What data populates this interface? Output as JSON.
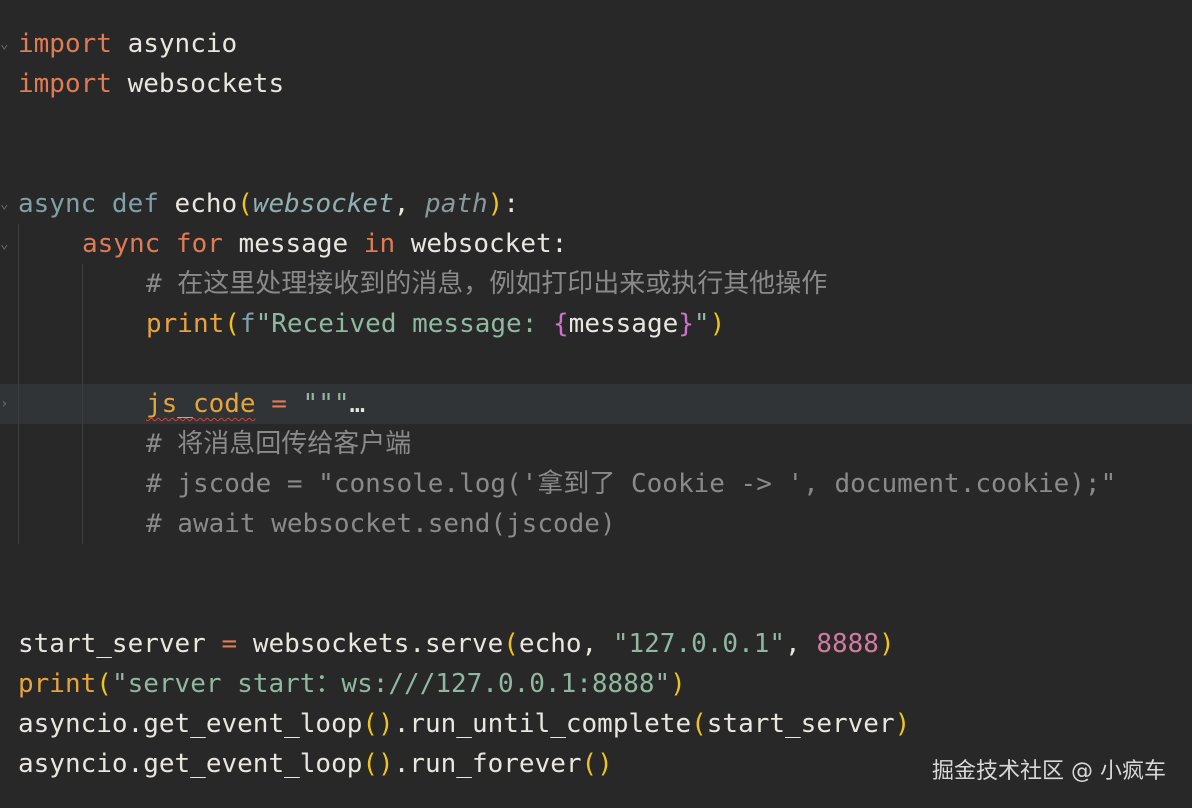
{
  "lines": {
    "l1_kw": "import",
    "l1_mod": " asyncio",
    "l2_kw": "import",
    "l2_mod": " websockets",
    "l5_async": "async",
    "l5_def": " def",
    "l5_name": " echo",
    "l5_p1": "websocket",
    "l5_comma": ", ",
    "l5_p2": "path",
    "l5_colon": ":",
    "l6_async": "async",
    "l6_for": " for",
    "l6_var": " message",
    "l6_in": " in",
    "l6_iter": " websocket:",
    "l7_comment": "# 在这里处理接收到的消息，例如打印出来或执行其他操作",
    "l8_print": "print",
    "l8_f": "f",
    "l8_str1": "\"Received message: ",
    "l8_var": "message",
    "l8_str2": "\"",
    "l10_var": "js_code",
    "l10_eq": " = ",
    "l10_str": "\"\"\"",
    "l10_ellipsis": "…",
    "l11_comment": "# 将消息回传给客户端",
    "l12_comment": "# jscode = \"console.log('拿到了 Cookie -> ', document.cookie);\"",
    "l13_comment": "# await websocket.send(jscode)",
    "l16_var": "start_server",
    "l16_eq": " = ",
    "l16_call": "websockets.serve",
    "l16_arg1": "echo, ",
    "l16_str": "\"127.0.0.1\"",
    "l16_comma": ", ",
    "l16_num": "8888",
    "l17_print": "print",
    "l17_str": "\"server start：ws:///127.0.0.1:8888\"",
    "l18_a": "asyncio.get_event_loop",
    "l18_b": ".run_until_complete",
    "l18_arg": "start_server",
    "l19_a": "asyncio.get_event_loop",
    "l19_b": ".run_forever"
  },
  "watermark": "掘金技术社区 @ 小疯车",
  "colors": {
    "background": "#282828",
    "keyword": "#e07b53",
    "string": "#8fb8a0",
    "number": "#d27aa0",
    "comment": "#8a8a8a",
    "builtin": "#e8a33d"
  }
}
